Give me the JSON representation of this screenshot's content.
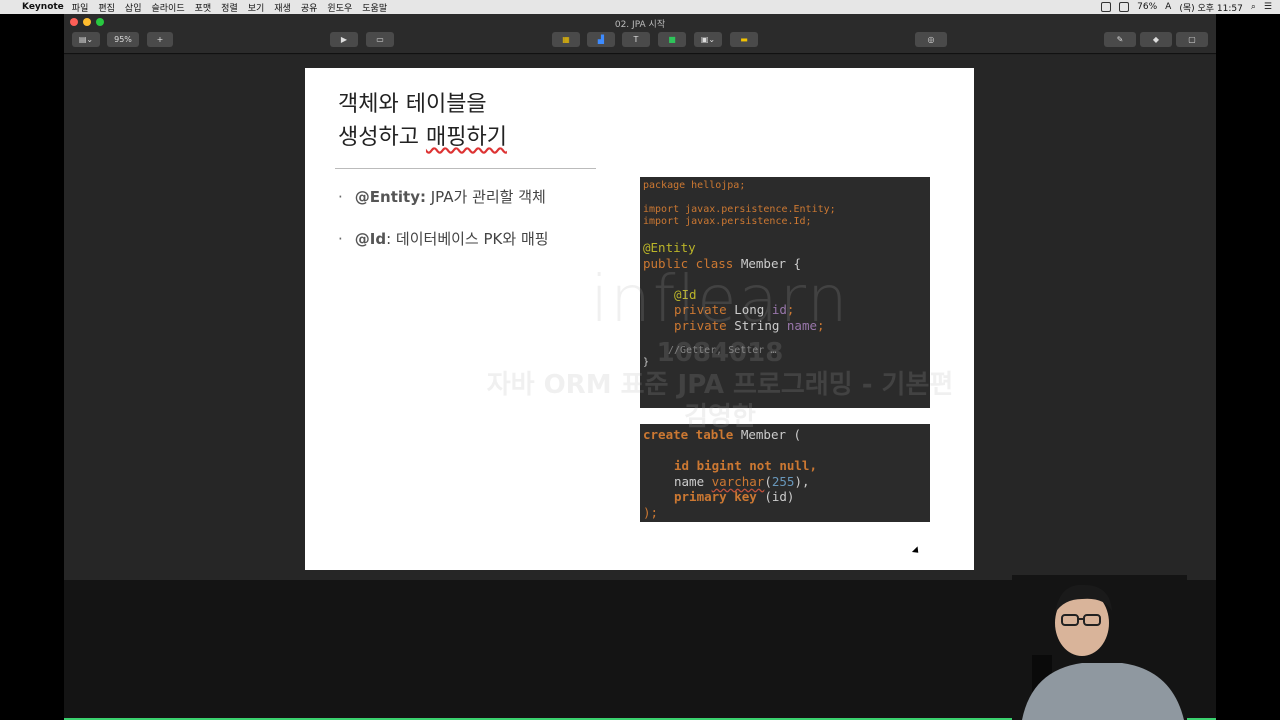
{
  "menubar": {
    "app": "Keynote",
    "items": [
      "파일",
      "편집",
      "삽입",
      "슬라이드",
      "포맷",
      "정렬",
      "보기",
      "재생",
      "공유",
      "윈도우",
      "도움말"
    ],
    "battery": "76%",
    "input_source": "A",
    "clock": "(목) 오후 11:57"
  },
  "window": {
    "doc_title": "02. JPA 시작",
    "zoom": "95%"
  },
  "slide": {
    "title_line1": "객체와 테이블을",
    "title_line2_a": "생성하고 ",
    "title_line2_b": "매핑하기",
    "bullets": [
      {
        "strong": "@Entity:",
        "text": " JPA가 관리할 객체"
      },
      {
        "strong": "@Id",
        "text": ": 데이터베이스 PK와 매핑"
      }
    ],
    "code1": {
      "package": "package hellojpa;",
      "import1": "import javax.persistence.Entity;",
      "import2": "import javax.persistence.Id;",
      "annotation": "@Entity",
      "class_kw": "public class",
      "class_name": " Member {",
      "id_ann": "@Id",
      "f1_kw": "private",
      "f1_type": " Long ",
      "f1_name": "id",
      "f2_kw": "private",
      "f2_type": " String ",
      "f2_name": "name",
      "comment": "//Getter, Setter …",
      "close": "}"
    },
    "code2": {
      "l1_kw": "create table",
      "l1_rest": " Member (",
      "l2": "id bigint not null,",
      "l3_name": "name ",
      "l3_type": "varchar",
      "l3_open": "(",
      "l3_num": "255",
      "l3_close": "),",
      "l4_kw": "primary key",
      "l4_rest": " (id)",
      "l5": ");"
    }
  },
  "watermark": {
    "logo": "inflearn",
    "id": "1084018",
    "course": "자바 ORM 표준 JPA 프로그래밍 - 기본편",
    "name": "김영한"
  }
}
